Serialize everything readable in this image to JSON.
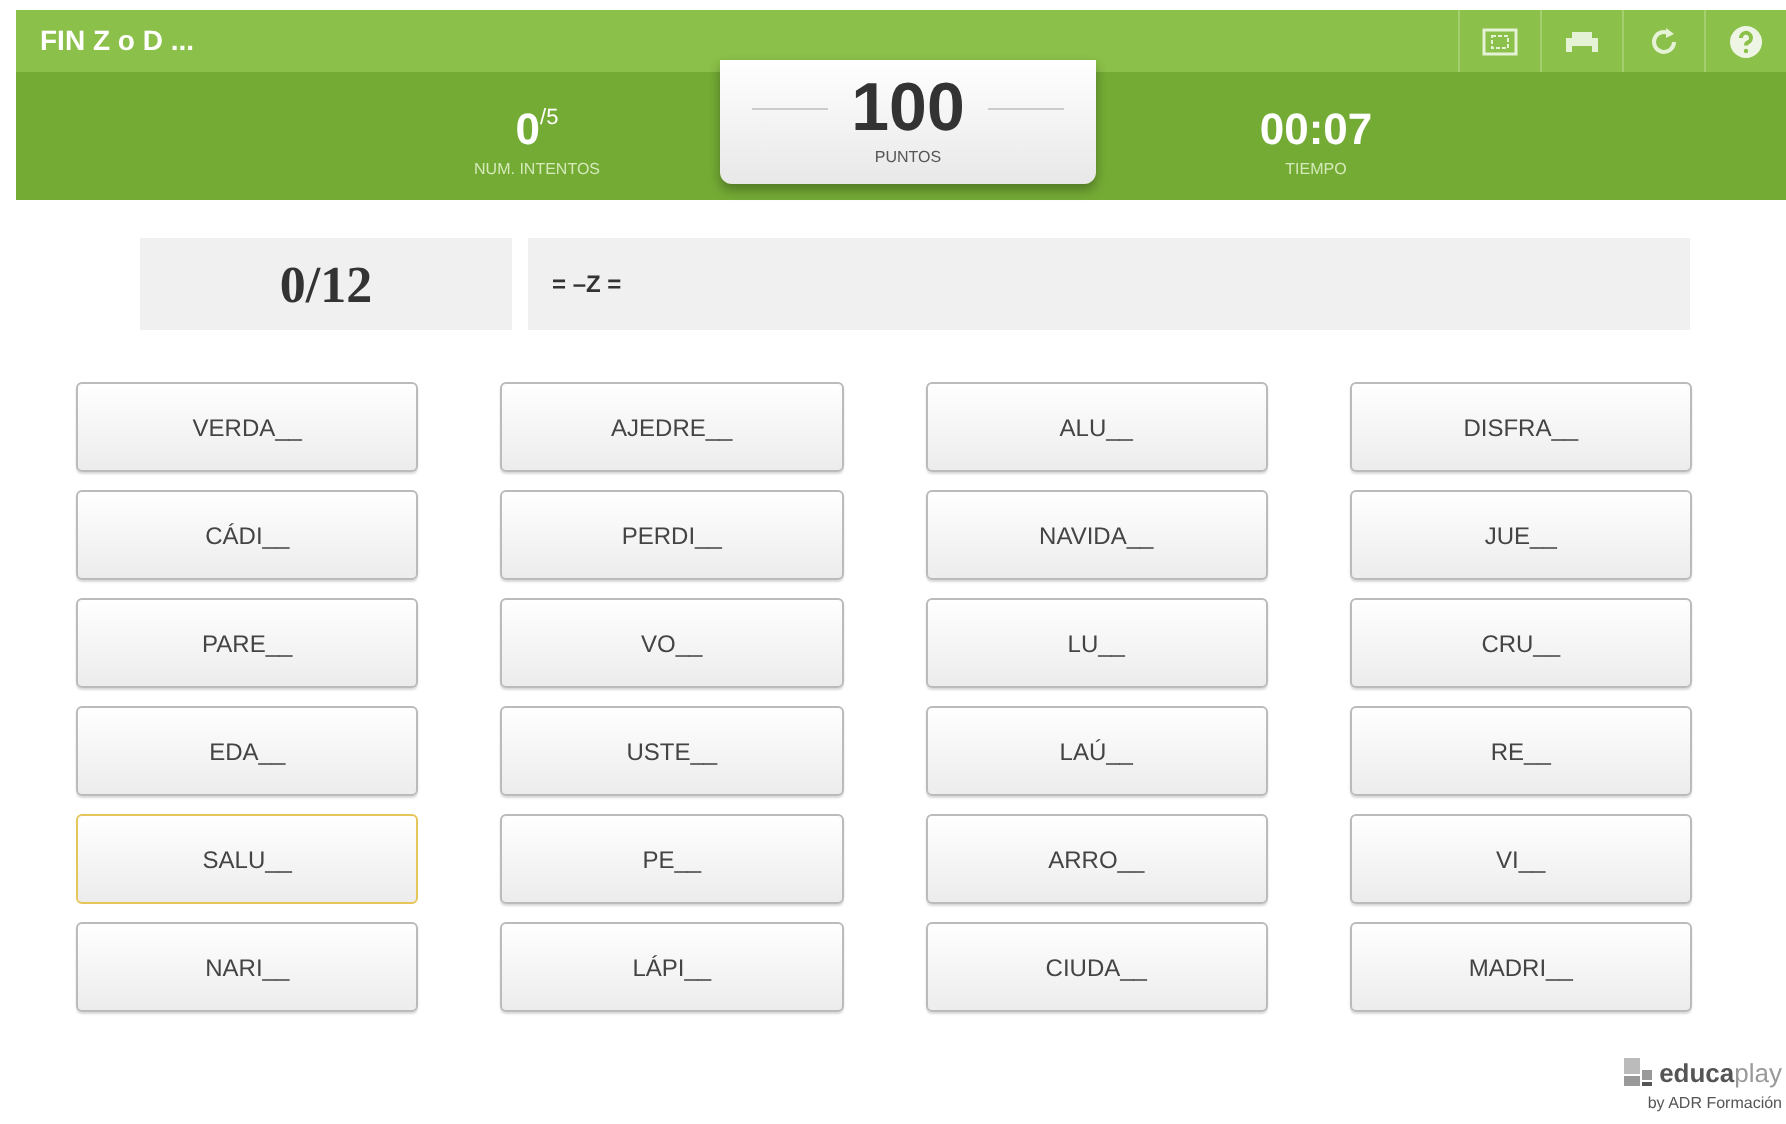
{
  "title": "FIN Z o D ...",
  "stats": {
    "attempts": "0",
    "attempts_total": "/5",
    "attempts_label": "NUM. INTENTOS",
    "points": "100",
    "points_label": "PUNTOS",
    "time": "00:07",
    "time_label": "TIEMPO"
  },
  "score": "0/12",
  "answer": "= –Z =",
  "words": [
    {
      "text": "VERDA__",
      "selected": false
    },
    {
      "text": "AJEDRE__",
      "selected": false
    },
    {
      "text": "ALU__",
      "selected": false
    },
    {
      "text": "DISFRA__",
      "selected": false
    },
    {
      "text": "CÁDI__",
      "selected": false
    },
    {
      "text": "PERDI__",
      "selected": false
    },
    {
      "text": "NAVIDA__",
      "selected": false
    },
    {
      "text": "JUE__",
      "selected": false
    },
    {
      "text": "PARE__",
      "selected": false
    },
    {
      "text": "VO__",
      "selected": false
    },
    {
      "text": "LU__",
      "selected": false
    },
    {
      "text": "CRU__",
      "selected": false
    },
    {
      "text": "EDA__",
      "selected": false
    },
    {
      "text": "USTE__",
      "selected": false
    },
    {
      "text": "LAÚ__",
      "selected": false
    },
    {
      "text": "RE__",
      "selected": false
    },
    {
      "text": "SALU__",
      "selected": true
    },
    {
      "text": "PE__",
      "selected": false
    },
    {
      "text": "ARRO__",
      "selected": false
    },
    {
      "text": "VI__",
      "selected": false
    },
    {
      "text": "NARI__",
      "selected": false
    },
    {
      "text": "LÁPI__",
      "selected": false
    },
    {
      "text": "CIUDA__",
      "selected": false
    },
    {
      "text": "MADRI__",
      "selected": false
    }
  ],
  "brand": {
    "name_bold": "educa",
    "name_light": "play",
    "byline": "by ADR Formación"
  }
}
